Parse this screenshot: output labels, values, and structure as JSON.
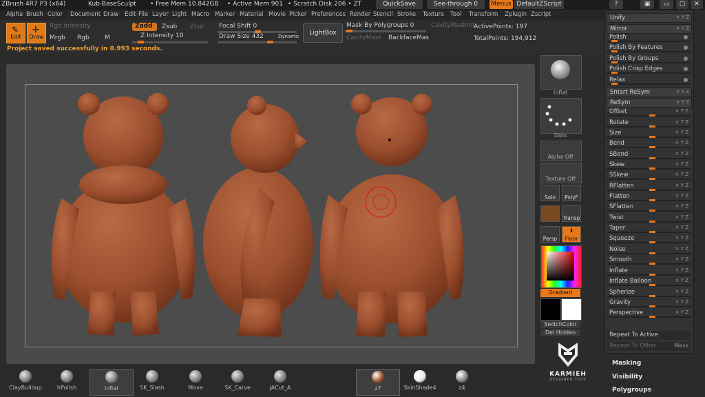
{
  "titlebar": {
    "app": "ZBrush 4R7 P3 (x64)",
    "doc": "Kub-BaseSculpt",
    "free_mem": "• Free Mem 10.842GB",
    "active_mem": "• Active Mem 901",
    "scratch": "• Scratch Disk 206 • ZT",
    "quicksave": "QuickSave",
    "seethrough": "See-through  0",
    "menus": "Menus",
    "script": "DefaultZScript"
  },
  "menubar": [
    "Alpha",
    "Brush",
    "Color",
    "Document",
    "Draw",
    "Edit",
    "File",
    "Layer",
    "Light",
    "Macro",
    "Marker",
    "Material",
    "Movie",
    "Picker",
    "Preferences",
    "Render",
    "Stencil",
    "Stroke",
    "Texture",
    "Tool",
    "Transform",
    "Zplugin",
    "Zscript"
  ],
  "toolbar": {
    "edit_label": "Edit",
    "draw_label": "Draw",
    "rgb_intensity": "Rgb Intensity",
    "mrgb": "Mrgb",
    "rgb": "Rgb",
    "m": "M",
    "zadd": "Zadd",
    "zsub": "Zsub",
    "zcut": "Zcut",
    "z_intensity": "Z Intensity 10",
    "focal_shift": "Focal Shift 0",
    "draw_size": "Draw Size 432",
    "dynamic": "Dynamic",
    "lightbox": "LightBox",
    "mask_by_polygroups": "Mask By Polygroups 0",
    "cavity_mask_int": "CavityMaskInt",
    "cavity_mask": "CavityMask",
    "backface_mask": "BackfaceMas",
    "active_points": "ActivePoints: 197",
    "total_points": "TotalPoints: 194,912",
    "status": "Project saved successfully in 0.993 seconds."
  },
  "right_column": {
    "inflat_label": "Inflat",
    "dots_label": "Dots",
    "alpha_off": "Alpha Off",
    "texture_off": "Texture Off",
    "solo": "Solo",
    "polyf": "PolyF",
    "transp": "Transp",
    "persp": "Persp",
    "floor": "Floor",
    "gradient": "Gradient",
    "switch_color": "SwitchColor",
    "del_hidden": "Del Hidden"
  },
  "deformation": [
    {
      "label": "Unify",
      "type": "hdr"
    },
    {
      "label": "Mirror",
      "type": "hdr"
    },
    {
      "label": "Polish",
      "type": "slider",
      "knob": 0.06
    },
    {
      "label": "Polish By Features",
      "type": "slider",
      "knob": 0.06
    },
    {
      "label": "Polish By Groups",
      "type": "slider",
      "knob": 0.06
    },
    {
      "label": "Polish Crisp Edges",
      "type": "slider",
      "knob": 0.06
    },
    {
      "label": "Relax",
      "type": "slider",
      "knob": 0.06
    },
    {
      "label": "Smart ReSym",
      "type": "hdr"
    },
    {
      "label": "ReSym",
      "type": "hdr"
    },
    {
      "label": "Offset",
      "type": "slider",
      "knob": 0.55
    },
    {
      "label": "Rotate",
      "type": "slider",
      "knob": 0.55
    },
    {
      "label": "Size",
      "type": "slider",
      "knob": 0.55
    },
    {
      "label": "Bend",
      "type": "slider",
      "knob": 0.55
    },
    {
      "label": "SBend",
      "type": "slider",
      "knob": 0.55
    },
    {
      "label": "Skew",
      "type": "slider",
      "knob": 0.55
    },
    {
      "label": "SSkew",
      "type": "slider",
      "knob": 0.55
    },
    {
      "label": "RFlatten",
      "type": "slider",
      "knob": 0.55
    },
    {
      "label": "Flatten",
      "type": "slider",
      "knob": 0.55
    },
    {
      "label": "SFlatten",
      "type": "slider",
      "knob": 0.55
    },
    {
      "label": "Twist",
      "type": "slider",
      "knob": 0.55
    },
    {
      "label": "Taper",
      "type": "slider",
      "knob": 0.55
    },
    {
      "label": "Squeeze",
      "type": "slider",
      "knob": 0.55
    },
    {
      "label": "Noise",
      "type": "slider",
      "knob": 0.55
    },
    {
      "label": "Smooth",
      "type": "slider",
      "knob": 0.55
    },
    {
      "label": "Inflate",
      "type": "slider",
      "knob": 0.55
    },
    {
      "label": "Inflate Balloon",
      "type": "slider",
      "knob": 0.55
    },
    {
      "label": "Spherize",
      "type": "slider",
      "knob": 0.55
    },
    {
      "label": "Gravity",
      "type": "slider",
      "knob": 0.55
    },
    {
      "label": "Perspective",
      "type": "slider",
      "knob": 0.55
    }
  ],
  "repeat_to_active": "Repeat To Active",
  "repeat_to_other": "Repeat To Other",
  "mask_btn": "Mask",
  "subpalettes": [
    "Masking",
    "Visibility",
    "Polygroups"
  ],
  "brushes": [
    {
      "label": "ClayBuildup",
      "selected": false
    },
    {
      "label": "hPolish",
      "selected": false
    },
    {
      "label": "Inflat",
      "selected": true
    },
    {
      "label": "SK_Slash",
      "selected": false
    },
    {
      "label": "Move",
      "selected": false
    },
    {
      "label": "SK_Carve",
      "selected": false
    },
    {
      "label": "JACut_A",
      "selected": false
    }
  ],
  "materials": [
    {
      "label": "z7",
      "selected": true,
      "color": "#a0532f"
    },
    {
      "label": "SkinShade4",
      "selected": false,
      "color": "#e8e8e8"
    },
    {
      "label": "z4",
      "selected": false,
      "color": "#8a8a8a"
    }
  ],
  "logo": {
    "title": "KARMIEH",
    "subtitle": "DESIGNER TOYS"
  },
  "colors": {
    "accent": "#e8781c",
    "bear": "#9c4f2e"
  }
}
